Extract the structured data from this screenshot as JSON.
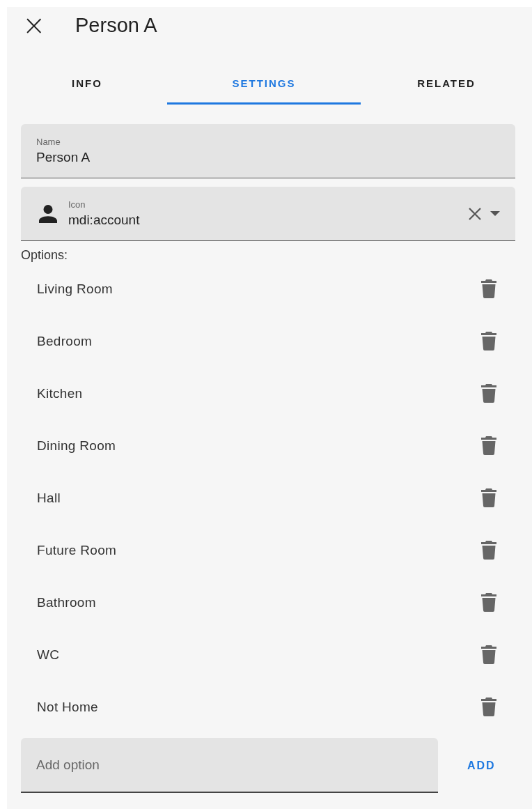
{
  "header": {
    "close": "×",
    "title": "Person A"
  },
  "tabs": [
    {
      "label": "INFO",
      "selected": false
    },
    {
      "label": "SETTINGS",
      "selected": true
    },
    {
      "label": "RELATED",
      "selected": false
    }
  ],
  "name_field": {
    "label": "Name",
    "value": "Person A"
  },
  "icon_field": {
    "label": "Icon",
    "value": "mdi:account"
  },
  "options_label": "Options:",
  "options": [
    "Living Room",
    "Bedroom",
    "Kitchen",
    "Dining Room",
    "Hall",
    "Future Room",
    "Bathroom",
    "WC",
    "Not Home"
  ],
  "add_field": {
    "placeholder": "Add option"
  },
  "add_button": "ADD"
}
